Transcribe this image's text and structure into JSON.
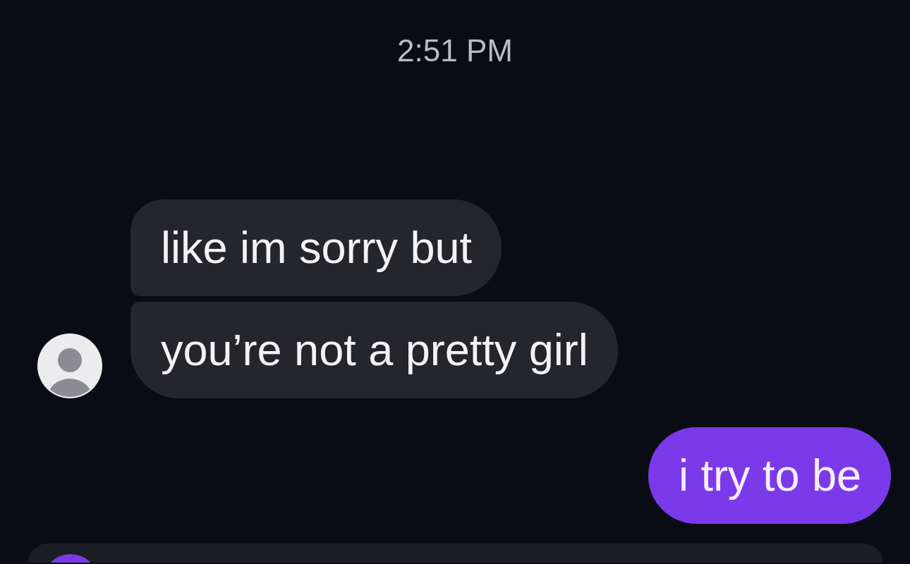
{
  "timestamp": "2:51 PM",
  "messages": [
    {
      "kind": "received",
      "text": "like im sorry but"
    },
    {
      "kind": "received",
      "text": "you’re not a pretty girl"
    },
    {
      "kind": "sent",
      "text": "i try to be"
    }
  ]
}
